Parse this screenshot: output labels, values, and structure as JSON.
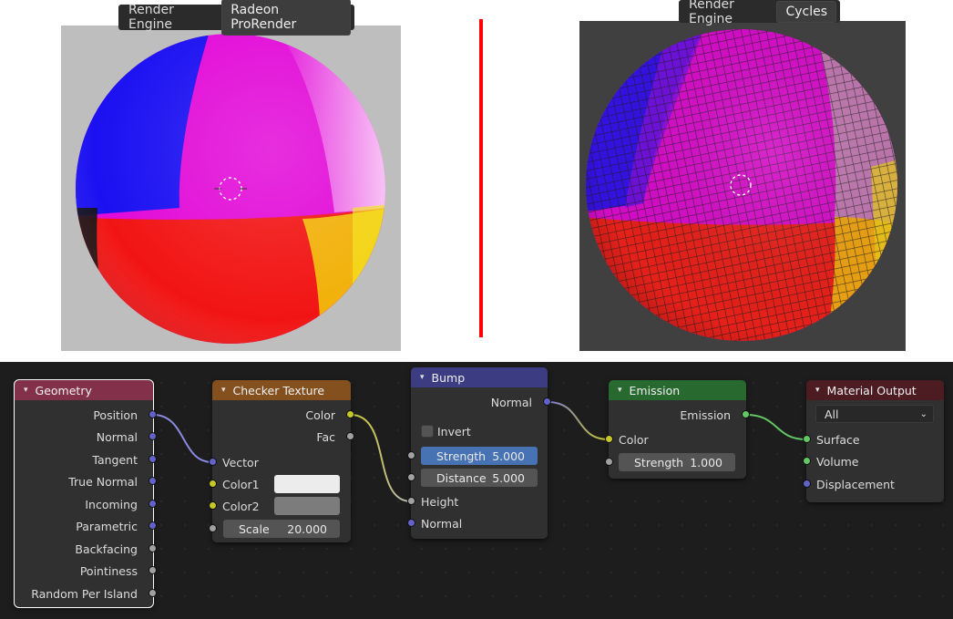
{
  "left_render": {
    "engine_label": "Render Engine",
    "engine_value": "Radeon ProRender"
  },
  "right_render": {
    "engine_label": "Render Engine",
    "engine_value": "Cycles"
  },
  "colors": {
    "divider": "#ff0000",
    "geometry_header": "#83314a",
    "texture_header": "#83501e",
    "vector_header": "#3c3c83",
    "shader_header": "#28692f",
    "output_header": "#4c1c22"
  },
  "nodes": {
    "geometry": {
      "title": "Geometry",
      "outputs": [
        "Position",
        "Normal",
        "Tangent",
        "True Normal",
        "Incoming",
        "Parametric",
        "Backfacing",
        "Pointiness",
        "Random Per Island"
      ]
    },
    "checker": {
      "title": "Checker Texture",
      "outputs": [
        "Color",
        "Fac"
      ],
      "inputs": [
        "Vector",
        "Color1",
        "Color2"
      ],
      "scale_label": "Scale",
      "scale_value": "20.000",
      "color1": "#ececec",
      "color2": "#7c7c7c"
    },
    "bump": {
      "title": "Bump",
      "output": "Normal",
      "invert_label": "Invert",
      "invert_checked": false,
      "strength_label": "Strength",
      "strength_value": "5.000",
      "distance_label": "Distance",
      "distance_value": "5.000",
      "inputs": [
        "Height",
        "Normal"
      ]
    },
    "emission": {
      "title": "Emission",
      "output": "Emission",
      "color_label": "Color",
      "strength_label": "Strength",
      "strength_value": "1.000"
    },
    "material_output": {
      "title": "Material Output",
      "target": "All",
      "inputs": [
        "Surface",
        "Volume",
        "Displacement"
      ]
    }
  }
}
